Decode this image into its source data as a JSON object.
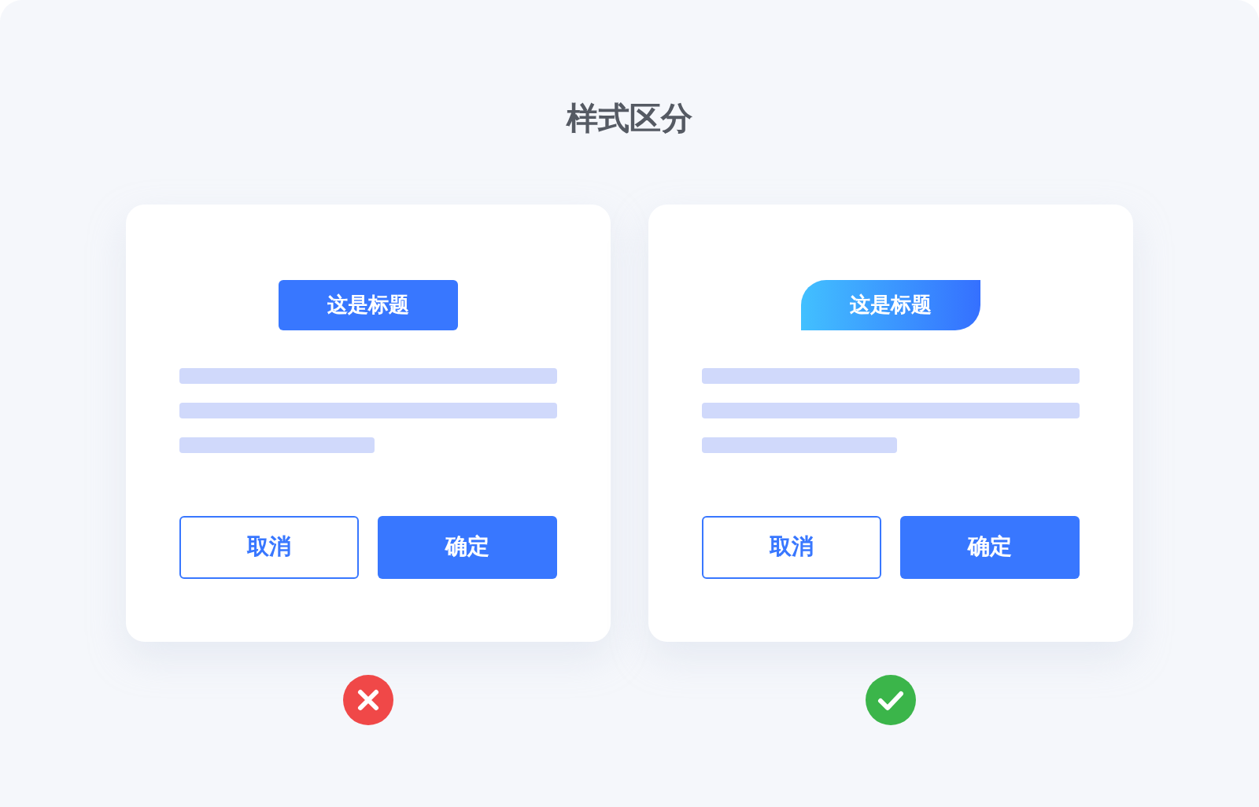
{
  "title": "样式区分",
  "examples": [
    {
      "kind": "wrong",
      "tag": "这是标题",
      "cancel": "取消",
      "confirm": "确定"
    },
    {
      "kind": "right",
      "tag": "这是标题",
      "cancel": "取消",
      "confirm": "确定"
    }
  ]
}
